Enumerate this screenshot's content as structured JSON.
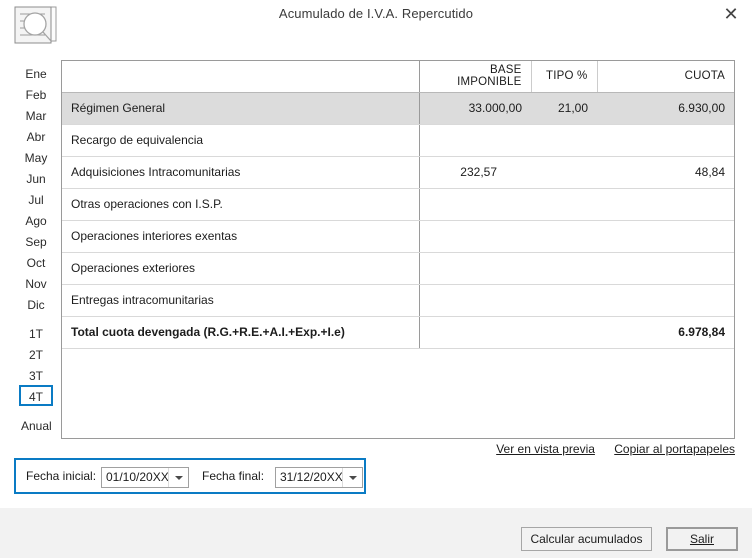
{
  "window": {
    "title": "Acumulado de I.V.A. Repercutido",
    "close_label": "✕",
    "doc_icon": "document-preview-icon"
  },
  "periods": {
    "months": [
      "Ene",
      "Feb",
      "Mar",
      "Abr",
      "May",
      "Jun",
      "Jul",
      "Ago",
      "Sep",
      "Oct",
      "Nov",
      "Dic"
    ],
    "quarters": [
      "1T",
      "2T",
      "3T",
      "4T"
    ],
    "annual": "Anual",
    "selected": "4T",
    "selection_color": "#0a7bc4"
  },
  "table": {
    "headers": {
      "concept": "",
      "base": "BASE IMPONIBLE",
      "tipo": "TIPO %",
      "cuota": "CUOTA"
    },
    "rows": [
      {
        "concept": "Régimen General",
        "base": "33.000,00",
        "tipo": "21,00",
        "cuota": "6.930,00",
        "highlight": true,
        "total": false
      },
      {
        "concept": "Recargo de equivalencia",
        "base": "",
        "tipo": "",
        "cuota": "",
        "highlight": false,
        "total": false
      },
      {
        "concept": "Adquisiciones Intracomunitarias",
        "base": "232,57",
        "tipo": "",
        "cuota": "48,84",
        "highlight": false,
        "total": false
      },
      {
        "concept": "Otras operaciones con I.S.P.",
        "base": "",
        "tipo": "",
        "cuota": "",
        "highlight": false,
        "total": false
      },
      {
        "concept": "Operaciones interiores exentas",
        "base": "",
        "tipo": "",
        "cuota": "",
        "highlight": false,
        "total": false
      },
      {
        "concept": "Operaciones exteriores",
        "base": "",
        "tipo": "",
        "cuota": "",
        "highlight": false,
        "total": false
      },
      {
        "concept": "Entregas intracomunitarias",
        "base": "",
        "tipo": "",
        "cuota": "",
        "highlight": false,
        "total": false
      },
      {
        "concept": "Total cuota devengada (R.G.+R.E.+A.I.+Exp.+I.e)",
        "base": "",
        "tipo": "",
        "cuota": "6.978,84",
        "highlight": false,
        "total": true
      }
    ]
  },
  "links": {
    "preview": "Ver en vista previa",
    "copy": "Copiar al portapapeles"
  },
  "dates": {
    "start_label": "Fecha inicial:",
    "start_value": "01/10/20XX",
    "end_label": "Fecha final:",
    "end_value": "31/12/20XX"
  },
  "footer": {
    "calculate": "Calcular acumulados",
    "exit": "Salir"
  }
}
